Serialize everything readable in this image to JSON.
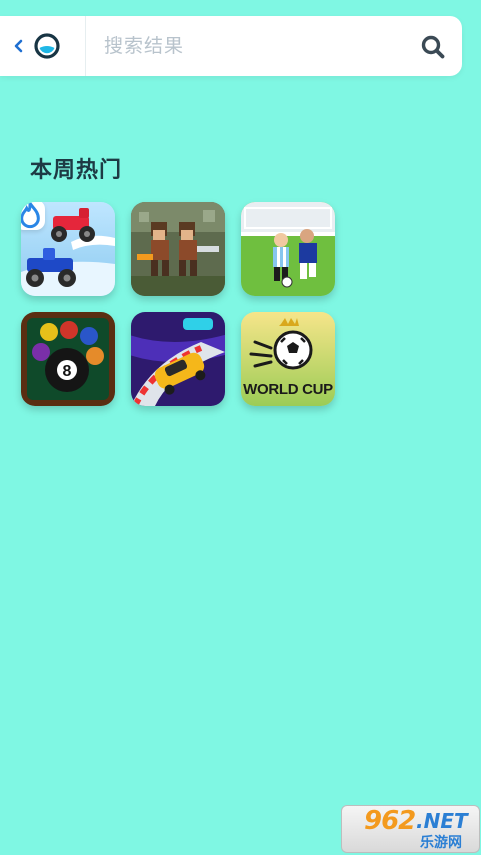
{
  "search": {
    "placeholder": "搜索结果"
  },
  "section": {
    "title": "本周热门"
  },
  "games": [
    {
      "id": "truck-race",
      "icon": "monster-truck-icon",
      "badge": "flame-badge-icon"
    },
    {
      "id": "pixel-warriors",
      "icon": "pixel-warriors-icon"
    },
    {
      "id": "soccer-players",
      "icon": "soccer-players-icon"
    },
    {
      "id": "eight-ball-pool",
      "icon": "billiards-icon",
      "ball_number": "8"
    },
    {
      "id": "car-race",
      "icon": "race-car-icon"
    },
    {
      "id": "world-cup",
      "icon": "soccer-ball-icon",
      "title": "WORLD CUP"
    }
  ],
  "watermark": {
    "number": "962",
    "domain": ".NET",
    "subtitle": "乐游网"
  },
  "colors": {
    "background": "#7ff7e3",
    "title": "#1d3a44",
    "placeholder": "#b8c3cc"
  }
}
